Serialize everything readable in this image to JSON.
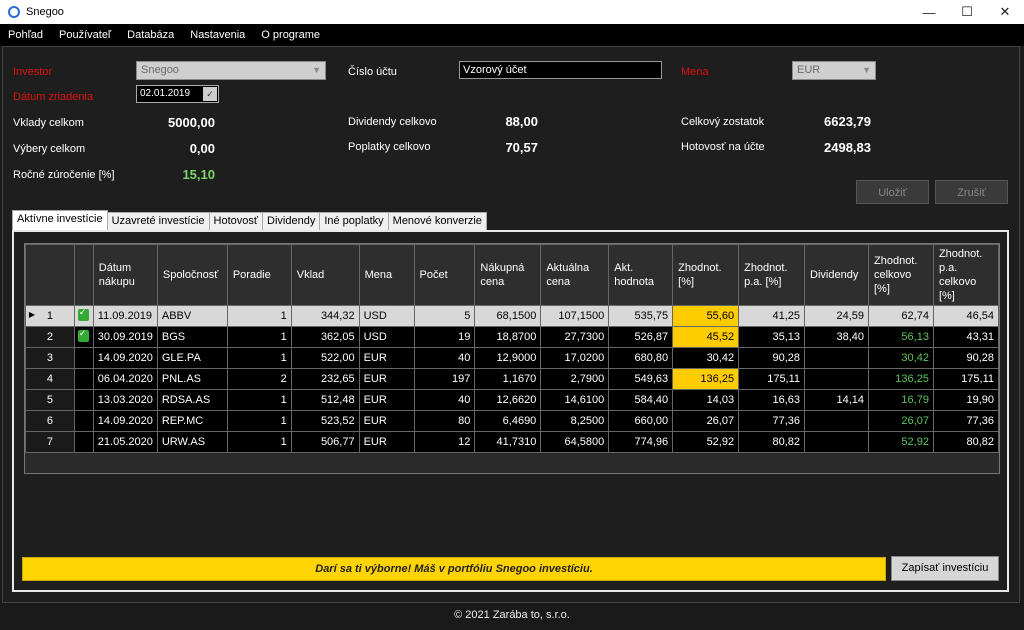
{
  "window": {
    "title": "Snegoo",
    "minimize": "—",
    "maximize": "☐",
    "close": "✕"
  },
  "menu": [
    "Pohľad",
    "Používateľ",
    "Databáza",
    "Nastavenia",
    "O programe"
  ],
  "form": {
    "investor_label": "Investor",
    "investor_value": "Snegoo",
    "date_label": "Dátum zriadenia",
    "date_value": "02.01.2019",
    "account_label": "Číslo účtu",
    "account_value": "Vzorový účet",
    "currency_label": "Mena",
    "currency_value": "EUR",
    "deposits_label": "Vklady celkom",
    "deposits_value": "5000,00",
    "withdrawals_label": "Výbery celkom",
    "withdrawals_value": "0,00",
    "annual_label": "Ročné zúročenie [%]",
    "annual_value": "15,10",
    "dividends_label": "Dividendy celkovo",
    "dividends_value": "88,00",
    "fees_label": "Poplatky celkovo",
    "fees_value": "70,57",
    "balance_label": "Celkový zostatok",
    "balance_value": "6623,79",
    "cash_label": "Hotovosť na účte",
    "cash_value": "2498,83",
    "save_label": "Uložiť",
    "cancel_label": "Zrušiť"
  },
  "tabs": [
    "Aktívne investície",
    "Uzavreté investície",
    "Hotovosť",
    "Dividendy",
    "Iné poplatky",
    "Menové konverzie"
  ],
  "table": {
    "headers": [
      "Dátum nákupu",
      "Spoločnosť",
      "Poradie",
      "Vklad",
      "Mena",
      "Počet",
      "Nákupná cena",
      "Aktuálna cena",
      "Akt. hodnota",
      "Zhodnot. [%]",
      "Zhodnot. p.a. [%]",
      "Dividendy",
      "Zhodnot. celkovo [%]",
      "Zhodnot. p.a. celkovo [%]"
    ],
    "rows": [
      {
        "n": "1",
        "icon": true,
        "date": "11.09.2019",
        "company": "ABBV",
        "order": "1",
        "deposit": "344,32",
        "currency": "USD",
        "count": "5",
        "buy": "68,1500",
        "current": "107,1500",
        "value": "535,75",
        "gain": "55,60",
        "gain_pa": "41,25",
        "div": "24,59",
        "total": "62,74",
        "total_pa": "46,54"
      },
      {
        "n": "2",
        "icon": true,
        "date": "30.09.2019",
        "company": "BGS",
        "order": "1",
        "deposit": "362,05",
        "currency": "USD",
        "count": "19",
        "buy": "18,8700",
        "current": "27,7300",
        "value": "526,87",
        "gain": "45,52",
        "gain_pa": "35,13",
        "div": "38,40",
        "total": "56,13",
        "total_pa": "43,31"
      },
      {
        "n": "3",
        "icon": false,
        "date": "14.09.2020",
        "company": "GLE.PA",
        "order": "1",
        "deposit": "522,00",
        "currency": "EUR",
        "count": "40",
        "buy": "12,9000",
        "current": "17,0200",
        "value": "680,80",
        "gain": "30,42",
        "gain_pa": "90,28",
        "div": "",
        "total": "30,42",
        "total_pa": "90,28"
      },
      {
        "n": "4",
        "icon": false,
        "date": "06.04.2020",
        "company": "PNL.AS",
        "order": "2",
        "deposit": "232,65",
        "currency": "EUR",
        "count": "197",
        "buy": "1,1670",
        "current": "2,7900",
        "value": "549,63",
        "gain": "136,25",
        "gain_pa": "175,11",
        "div": "",
        "total": "136,25",
        "total_pa": "175,11"
      },
      {
        "n": "5",
        "icon": false,
        "date": "13.03.2020",
        "company": "RDSA.AS",
        "order": "1",
        "deposit": "512,48",
        "currency": "EUR",
        "count": "40",
        "buy": "12,6620",
        "current": "14,6100",
        "value": "584,40",
        "gain": "14,03",
        "gain_pa": "16,63",
        "div": "14,14",
        "total": "16,79",
        "total_pa": "19,90"
      },
      {
        "n": "6",
        "icon": false,
        "date": "14.09.2020",
        "company": "REP.MC",
        "order": "1",
        "deposit": "523,52",
        "currency": "EUR",
        "count": "80",
        "buy": "6,4690",
        "current": "8,2500",
        "value": "660,00",
        "gain": "26,07",
        "gain_pa": "77,36",
        "div": "",
        "total": "26,07",
        "total_pa": "77,36"
      },
      {
        "n": "7",
        "icon": false,
        "date": "21.05.2020",
        "company": "URW.AS",
        "order": "1",
        "deposit": "506,77",
        "currency": "EUR",
        "count": "12",
        "buy": "41,7310",
        "current": "64,5800",
        "value": "774,96",
        "gain": "52,92",
        "gain_pa": "80,82",
        "div": "",
        "total": "52,92",
        "total_pa": "80,82"
      }
    ]
  },
  "banner": "Darí sa ti výborne! Máš v portfóliu Snegoo investíciu.",
  "write_button": "Zapísať investíciu",
  "footer": "© 2021 Zarába to, s.r.o.",
  "colors": {
    "accent_red": "#e01010",
    "highlight_yellow": "#ffcc00",
    "positive_green": "#5fc45f"
  }
}
